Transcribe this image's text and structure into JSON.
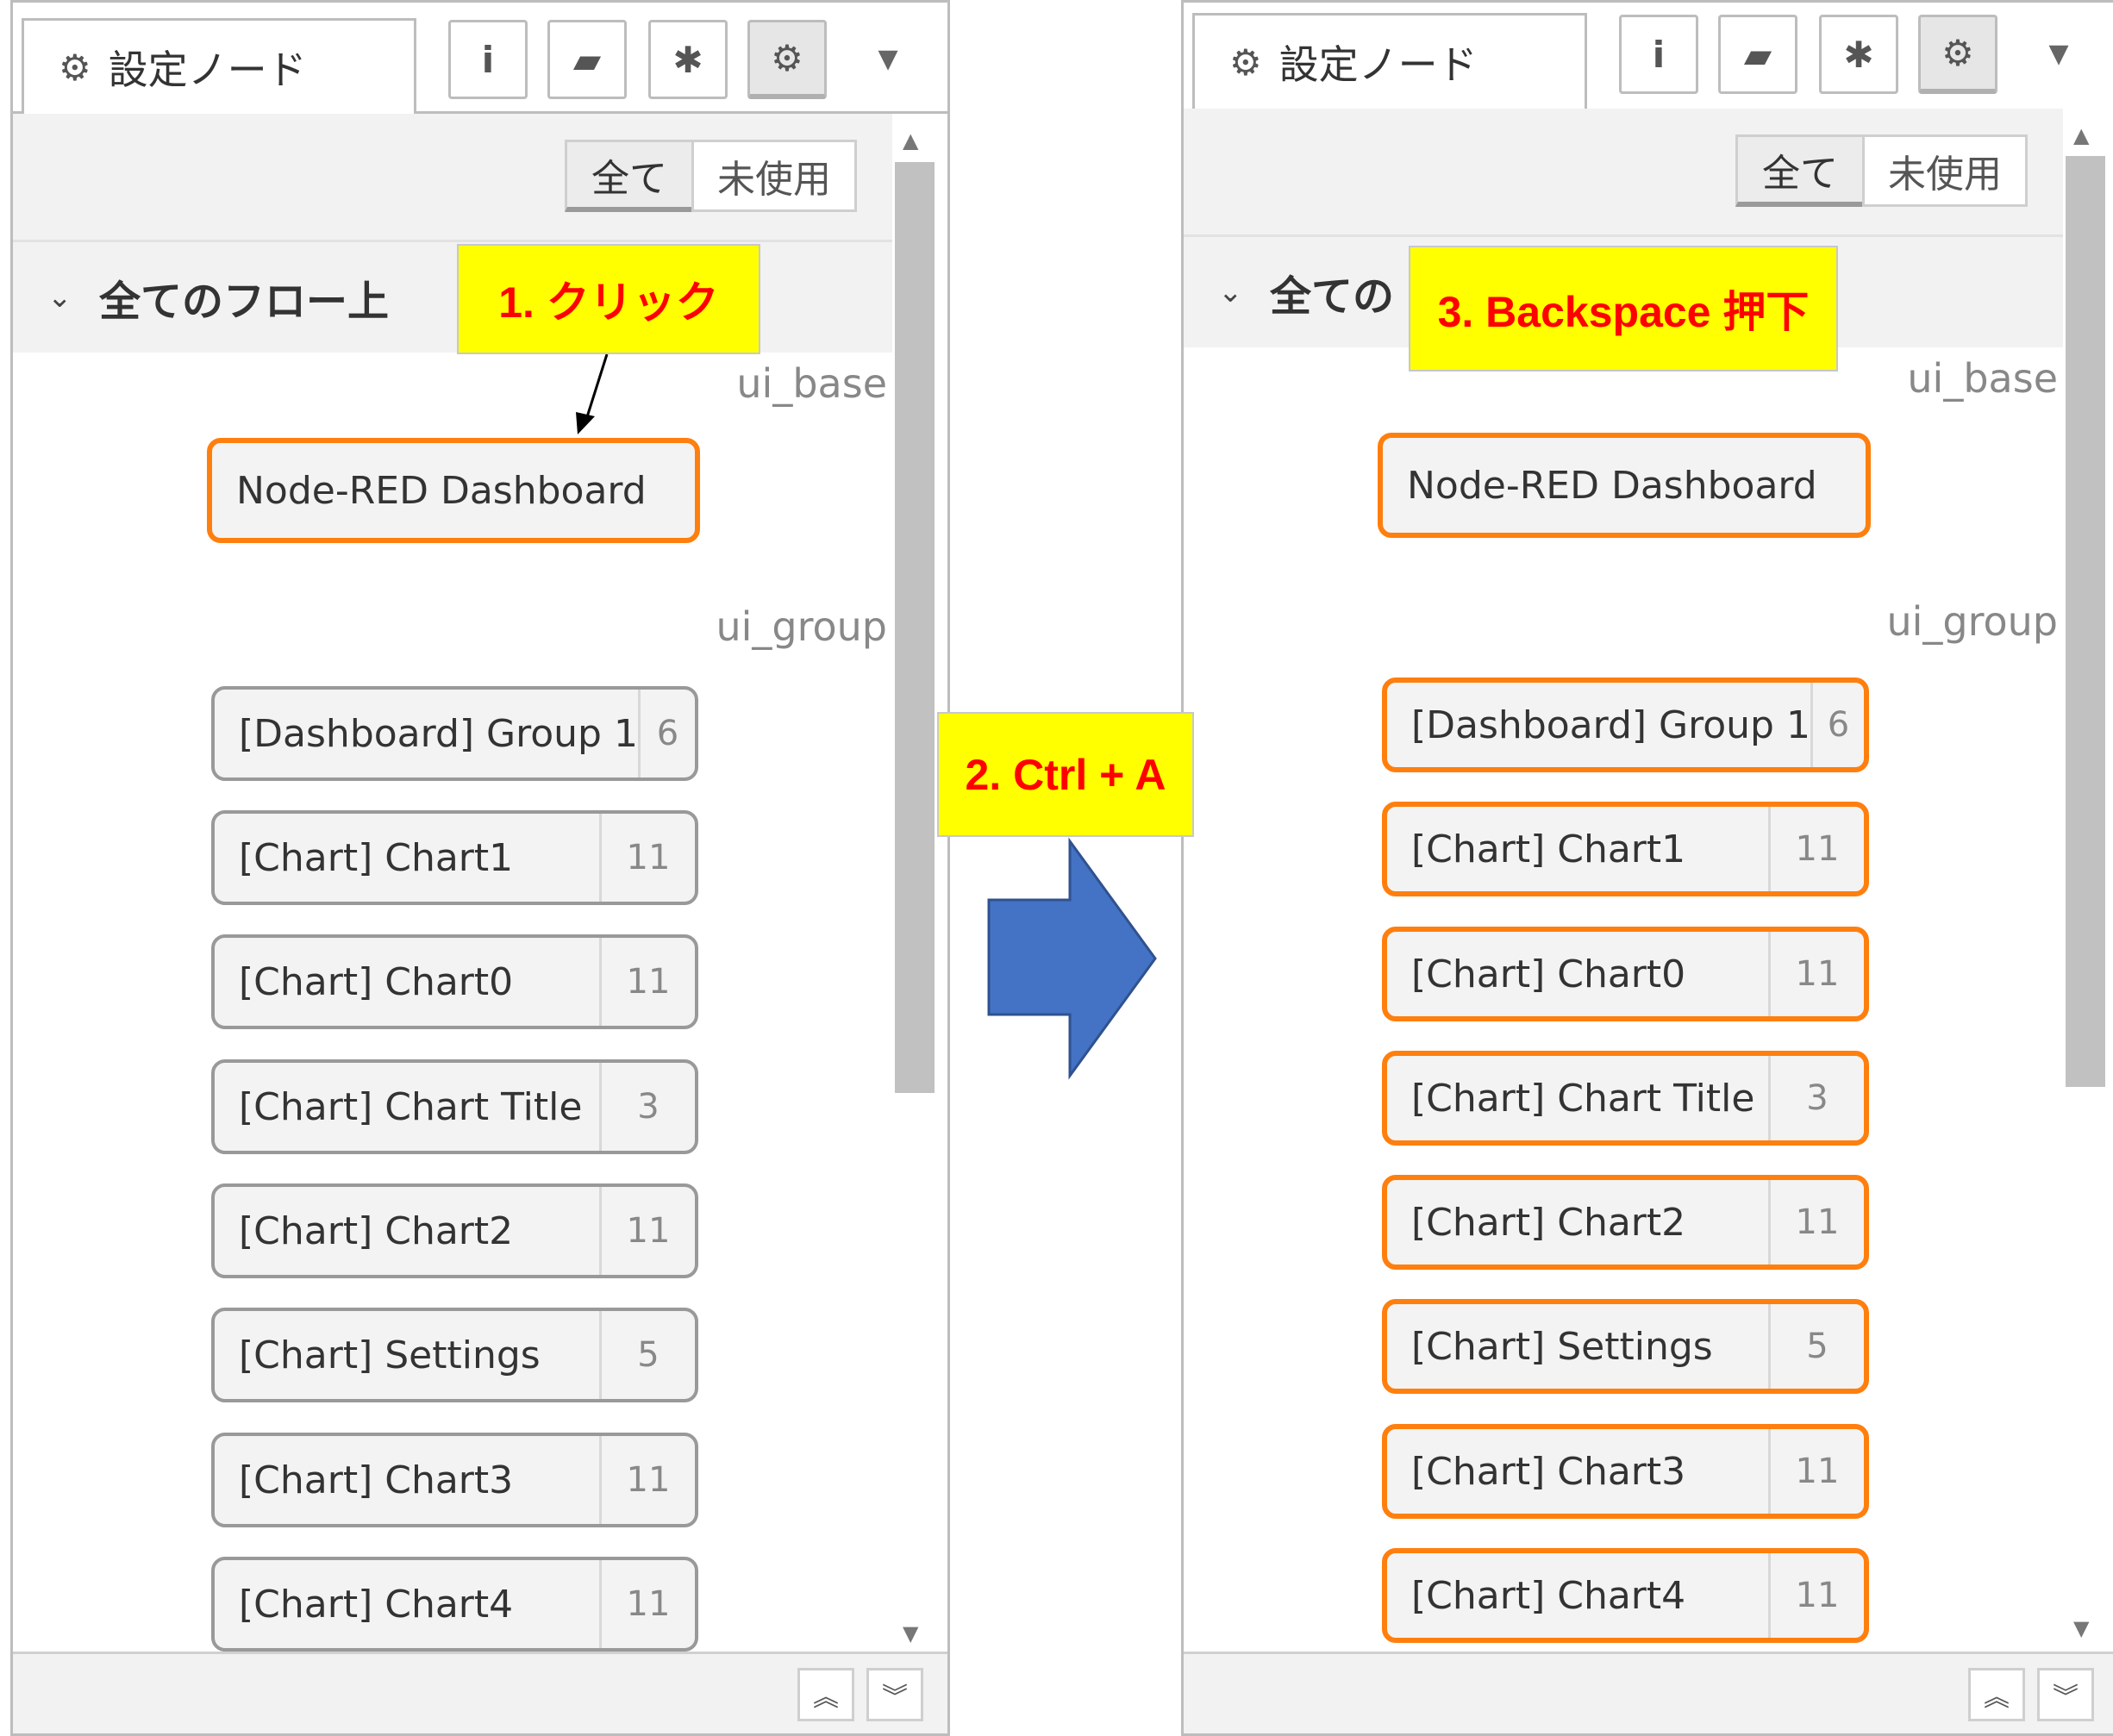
{
  "panels": [
    {
      "tab_label": "設定ノード",
      "filter": {
        "all": "全て",
        "unused": "未使用"
      },
      "section_title": "全てのフロー上",
      "groups": {
        "base": "ui_base",
        "group": "ui_group"
      },
      "base_node": "Node-RED Dashboard",
      "nodes": [
        {
          "label": "[Dashboard] Group 1",
          "count": "6"
        },
        {
          "label": "[Chart] Chart1",
          "count": "11"
        },
        {
          "label": "[Chart] Chart0",
          "count": "11"
        },
        {
          "label": "[Chart] Chart Title",
          "count": "3"
        },
        {
          "label": "[Chart] Chart2",
          "count": "11"
        },
        {
          "label": "[Chart] Settings",
          "count": "5"
        },
        {
          "label": "[Chart] Chart3",
          "count": "11"
        },
        {
          "label": "[Chart] Chart4",
          "count": "11"
        }
      ]
    },
    {
      "tab_label": "設定ノード",
      "filter": {
        "all": "全て",
        "unused": "未使用"
      },
      "section_title": "全ての",
      "groups": {
        "base": "ui_base",
        "group": "ui_group"
      },
      "base_node": "Node-RED Dashboard",
      "nodes": [
        {
          "label": "[Dashboard] Group 1",
          "count": "6"
        },
        {
          "label": "[Chart] Chart1",
          "count": "11"
        },
        {
          "label": "[Chart] Chart0",
          "count": "11"
        },
        {
          "label": "[Chart] Chart Title",
          "count": "3"
        },
        {
          "label": "[Chart] Chart2",
          "count": "11"
        },
        {
          "label": "[Chart] Settings",
          "count": "5"
        },
        {
          "label": "[Chart] Chart3",
          "count": "11"
        },
        {
          "label": "[Chart] Chart4",
          "count": "11"
        }
      ]
    }
  ],
  "callouts": {
    "step1": "1. クリック",
    "step2": "2. Ctrl + A",
    "step3": "3. Backspace 押下"
  },
  "icons": {
    "tab": "gear-icon",
    "buttons": [
      "info-icon",
      "book-icon",
      "bug-icon",
      "gear-icon",
      "caret-down-icon"
    ],
    "footer": [
      "double-chevron-up-icon",
      "double-chevron-down-icon"
    ]
  },
  "colors": {
    "selected_border": "#ff7f0e",
    "callout_bg": "#ffff00",
    "callout_text": "#ff0000",
    "arrow": "#4472c4"
  }
}
